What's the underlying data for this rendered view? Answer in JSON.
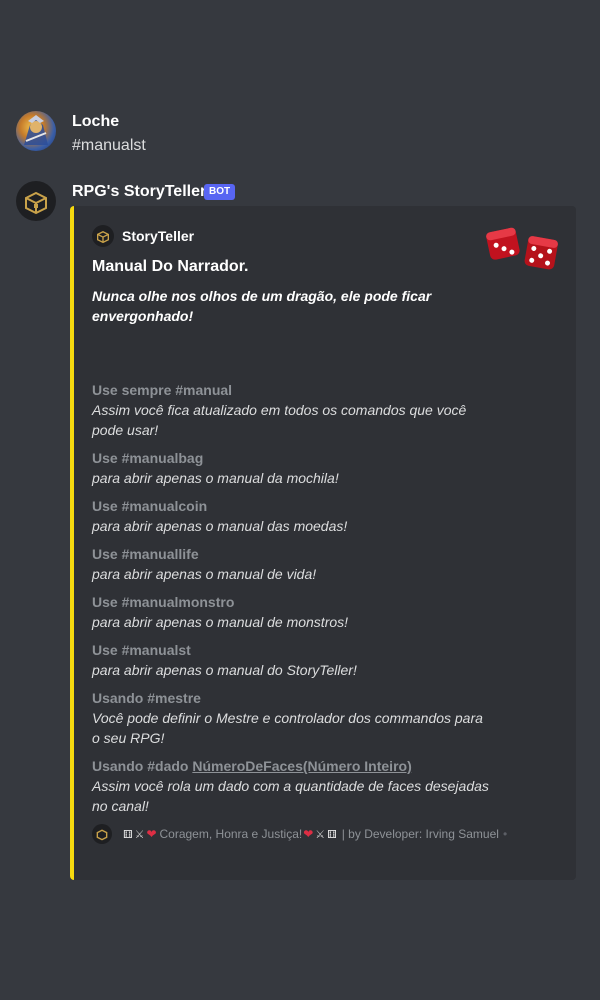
{
  "user_message": {
    "username": "Loche",
    "text": "#manualst"
  },
  "bot_message": {
    "username": "RPG's StoryTeller",
    "badge": "BOT",
    "embed": {
      "accent_color": "#f6d90f",
      "author": "StoryTeller",
      "title": "Manual Do Narrador.",
      "description": "Nunca olhe nos olhos de um dragão, ele pode ficar envergonhado!",
      "fields": [
        {
          "name": "Use sempre #manual",
          "value": "Assim você fica atualizado em todos os comandos que você pode usar!"
        },
        {
          "name": "Use #manualbag",
          "value": "para abrir apenas o manual da mochila!"
        },
        {
          "name": "Use #manualcoin",
          "value": "para abrir apenas o manual das moedas!"
        },
        {
          "name": "Use #manuallife",
          "value": "para abrir apenas o manual de vida!"
        },
        {
          "name": "Use #manualmonstro",
          "value": "para abrir apenas o manual de monstros!"
        },
        {
          "name": "Use #manualst",
          "value": "para abrir apenas o manual do StoryTeller!"
        },
        {
          "name": "Usando #mestre",
          "value": "Você pode definir o Mestre e controlador dos commandos para o seu RPG!"
        }
      ],
      "dice_field": {
        "name_prefix": "Usando #dado ",
        "name_link": "NúmeroDeFaces(Número Inteiro)",
        "value": "Assim você rola um dado com a quantidade de faces desejadas no canal!"
      },
      "footer": {
        "text": "Coragem, Honra e Justiça!",
        "developer": "| by Developer: Irving Samuel",
        "separator": "•"
      }
    }
  },
  "icons": {
    "user_avatar": "warrior-avatar-icon",
    "bot_avatar": "treasure-chest-icon",
    "thumbnail": "red-dice-icon",
    "footer_emojis": [
      "game-die-icon",
      "crossed-swords-icon",
      "heart-icon"
    ]
  },
  "colors": {
    "background": "#36393f",
    "embed_background": "#2f3136",
    "badge": "#5865f2",
    "field_name": "#8e9297"
  }
}
